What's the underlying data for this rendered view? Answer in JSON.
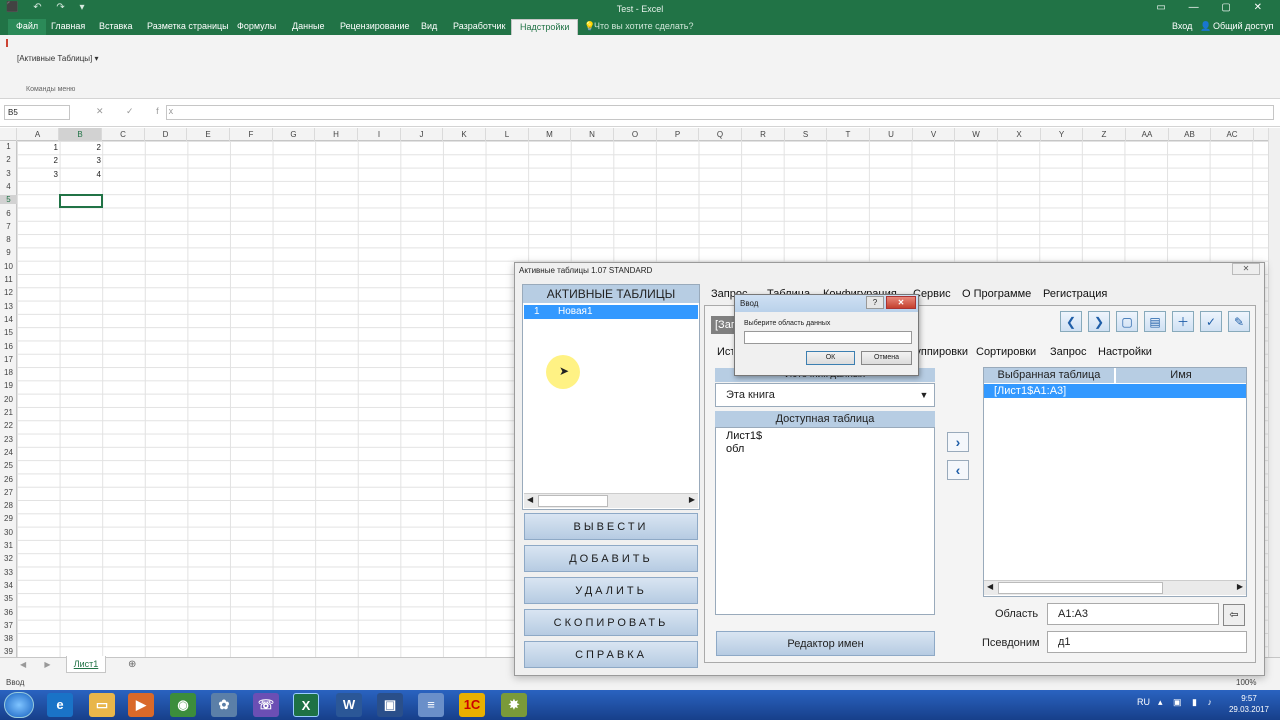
{
  "titlebar": {
    "title": "Test - Excel",
    "qat": "⬛ ↶ ↷ ▾",
    "winctl": "▭ — ▢ ✕"
  },
  "ribbon_tabs": [
    {
      "label": "Файл"
    },
    {
      "label": "Главная"
    },
    {
      "label": "Вставка"
    },
    {
      "label": "Разметка страницы"
    },
    {
      "label": "Формулы"
    },
    {
      "label": "Данные"
    },
    {
      "label": "Рецензирование"
    },
    {
      "label": "Вид"
    },
    {
      "label": "Разработчик"
    },
    {
      "label": "Надстройки"
    }
  ],
  "tell_me": "Что вы хотите сделать?",
  "signin": "Вход",
  "share": "Общий доступ",
  "ribbon": {
    "dropdown": "[Активные Таблицы]",
    "group_label": "Команды меню"
  },
  "formula_bar": {
    "name_box": "B5",
    "buttons": "✕ ✓ fx"
  },
  "columns": [
    "A",
    "B",
    "C",
    "D",
    "E",
    "F",
    "G",
    "H",
    "I",
    "J",
    "K",
    "L",
    "M",
    "N",
    "O",
    "P",
    "Q",
    "R",
    "S",
    "T",
    "U",
    "V",
    "W",
    "X",
    "Y",
    "Z",
    "AA",
    "AB",
    "AC"
  ],
  "rows": [
    "1",
    "2",
    "3",
    "4",
    "5",
    "6",
    "7",
    "8",
    "9",
    "10",
    "11",
    "12",
    "13",
    "14",
    "15",
    "16",
    "17",
    "18",
    "19",
    "20",
    "21",
    "22",
    "23",
    "24",
    "25",
    "26",
    "27",
    "28",
    "29",
    "30",
    "31",
    "32",
    "33",
    "34",
    "35",
    "36",
    "37",
    "38",
    "39"
  ],
  "cells": {
    "A1": "1",
    "B1": "2",
    "A2": "2",
    "B2": "3",
    "A3": "3",
    "B3": "4"
  },
  "sheet_tab": "Лист1",
  "status": {
    "mode": "Ввод",
    "zoom": "100%"
  },
  "taskbar": {
    "lang": "RU",
    "time": "9:57",
    "date": "29.03.2017"
  },
  "dialog": {
    "title": "Активные таблицы 1.07 STANDARD",
    "close": "✕",
    "left_header": "АКТИВНЫЕ ТАБЛИЦЫ",
    "list_item": {
      "num": "1",
      "name": "Новая1"
    },
    "buttons": {
      "output": "ВЫВЕСТИ",
      "add": "ДОБАВИТЬ",
      "delete": "УДАЛИТЬ",
      "copy": "СКОПИРОВАТЬ",
      "help": "СПРАВКА"
    },
    "top_tabs": [
      {
        "label": "Запрос"
      },
      {
        "label": "Таблица"
      },
      {
        "label": "Конфигурация"
      },
      {
        "label": "Сервис"
      },
      {
        "label": "О Программе"
      },
      {
        "label": "Регистрация"
      }
    ],
    "query_label": "[Запрос]",
    "sub_tabs": [
      {
        "label": "Источники"
      },
      {
        "label": "Группировки"
      },
      {
        "label": "Сортировки"
      },
      {
        "label": "Запрос"
      },
      {
        "label": "Настройки"
      }
    ],
    "source_header": "Источник данных",
    "source_value": "Эта книга",
    "available_header": "Доступная таблица",
    "available_items": [
      "Лист1$",
      "обл"
    ],
    "selected_headers": {
      "table": "Выбранная таблица",
      "name": "Имя"
    },
    "selected_row": "[Лист1$A1:A3]",
    "area_label": "Область",
    "area_value": "A1:A3",
    "alias_label": "Псевдоним",
    "alias_value": "д1",
    "names_editor": "Редактор имен"
  },
  "input_dialog": {
    "title": "Ввод",
    "help": "?",
    "close": "✕",
    "prompt": "Выберите область данных",
    "value": "",
    "ok": "ОК",
    "cancel": "Отмена"
  },
  "colors": {
    "excel_green": "#217346",
    "selection_blue": "#3399ff",
    "header_blue": "#b7cde3"
  }
}
